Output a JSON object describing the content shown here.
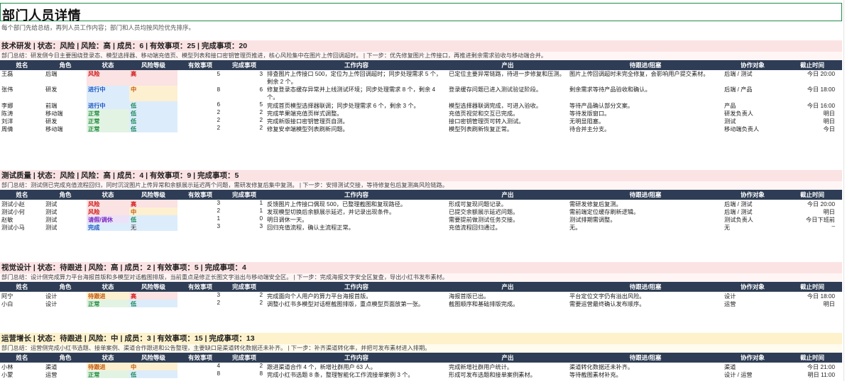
{
  "page": {
    "title": "部门人员详情",
    "subtitle": "每个部门先给总结，再列人员工作内容；部门和人员均按风险优先排序。"
  },
  "columns": [
    "姓名",
    "角色",
    "状态",
    "风险等级",
    "有效事项",
    "完成事项",
    "工作内容",
    "产出",
    "待跟进/阻塞",
    "协作对象",
    "截止时间"
  ],
  "sections": [
    {
      "header": "技术研发 | 状态：风险 | 风险：高 | 成员：6 | 有效事项：25 | 完成事项：20",
      "summary": "部门总结：研发侧今日主要围绕登录态、模型选择器、移动端充值页、模型列表和接口密钥管理页推进，核心风险集中在图片上传回调超时。 | 下一步：优先修复图片上传接口，再推进剩余需求验收与移动端合并。",
      "rows": [
        {
          "name": "王磊",
          "role": "后端",
          "status": "风险",
          "risk": "高",
          "eff": "5",
          "done": "3",
          "work": "排查图片上传接口 500，定位为上传回调超时；同步处理需求 5 个，剩余 2 个。",
          "out": "已定位主要异常链路，待进一步修复和压测。",
          "block": "图片上传回调超时未完全修复，会影响用户提交素材。",
          "collab": "后端 / 测试",
          "due": "今日 20:00"
        },
        {
          "name": "张伟",
          "role": "研发",
          "status": "进行中",
          "risk": "中",
          "eff": "8",
          "done": "6",
          "work": "修复登录态缓存异常并上线测试环境；同步处理需求 8 个，剩余 4 个。",
          "out": "登录缓存问题已进入测试验证阶段。",
          "block": "剩余需求等待产品验收和确认。",
          "collab": "后端 / 产品",
          "due": "今日 18:00"
        },
        {
          "name": "李娜",
          "role": "前端",
          "status": "进行中",
          "risk": "低",
          "eff": "6",
          "done": "5",
          "work": "完成首页模型选择器联调；同步处理需求 6 个，剩余 3 个。",
          "out": "模型选择器联调完成，可进入验收。",
          "block": "等待产品确认部分文案。",
          "collab": "产品",
          "due": "今日 16:00"
        },
        {
          "name": "陈涛",
          "role": "移动端",
          "status": "正常",
          "risk": "低",
          "eff": "2",
          "done": "2",
          "work": "完成苹果端充值页样式调整。",
          "out": "充值页视觉和交互已完成。",
          "block": "等待发版窗口。",
          "collab": "研发负责人",
          "due": "明日"
        },
        {
          "name": "刘洋",
          "role": "研发",
          "status": "正常",
          "risk": "低",
          "eff": "2",
          "done": "2",
          "work": "完成新版接口密钥管理页自测。",
          "out": "接口密钥管理页可转入测试。",
          "block": "无明显阻塞。",
          "collab": "测试",
          "due": "明日"
        },
        {
          "name": "周倩",
          "role": "移动端",
          "status": "正常",
          "risk": "低",
          "eff": "2",
          "done": "2",
          "work": "修复安卓端模型列表刷新问题。",
          "out": "模型列表刷新恢复正常。",
          "block": "待合并主分支。",
          "collab": "移动端负责人",
          "due": "今日"
        }
      ]
    },
    {
      "header": "测试质量 | 状态：风险 | 风险：高 | 成员：4 | 有效事项：9 | 完成事项：5",
      "summary": "部门总结：测试侧已完成充值流程回归，同时沉淀图片上传异常和余额展示延迟两个问题，需研发修复后集中复测。 | 下一步：安排测试交接，等待修复包后复测高风险链路。",
      "rows": [
        {
          "name": "测试小赵",
          "role": "测试",
          "status": "风险",
          "risk": "高",
          "eff": "3",
          "done": "1",
          "work": "反馈图片上传接口偶现 500，已整理截图和复现路径。",
          "out": "形成可复现问题记录。",
          "block": "需研发修复后复测。",
          "collab": "后端 / 测试",
          "due": "今日 20:00"
        },
        {
          "name": "测试小何",
          "role": "测试",
          "status": "风险",
          "risk": "中",
          "eff": "2",
          "done": "1",
          "work": "发现模型切换后余额展示延迟，并记录出现条件。",
          "out": "已提交余额展示延迟问题。",
          "block": "需前端定位缓存刷新逻辑。",
          "collab": "后端 / 测试",
          "due": "明日"
        },
        {
          "name": "赵敏",
          "role": "测试",
          "status": "请假/调休",
          "risk": "低",
          "eff": "1",
          "done": "0",
          "work": "明日调休一天。",
          "out": "需要提前做测试任务交接。",
          "block": "测试排期需调整。",
          "collab": "测试负责人",
          "due": "今日下班前"
        },
        {
          "name": "测试小马",
          "role": "测试",
          "status": "完成",
          "risk": "无",
          "eff": "3",
          "done": "3",
          "work": "回归充值流程，确认主流程正常。",
          "out": "充值流程回归通过。",
          "block": "无。",
          "collab": "无",
          "due": "–"
        }
      ]
    },
    {
      "header": "视觉设计 | 状态：待跟进 | 风险：高 | 成员：2 | 有效事项：5 | 完成事项：4",
      "summary": "部门总结：设计侧完成算力平台海报首版和多模型对话截图排版，当前重点是修正长图文字溢出与移动端安全区。 | 下一步：完成海报文字安全区复查，导出小红书发布素材。",
      "rows": [
        {
          "name": "阿宁",
          "role": "设计",
          "status": "待跟进",
          "risk": "高",
          "eff": "3",
          "done": "2",
          "work": "完成面向个人用户的算力平台海报首版。",
          "out": "海报首版已出。",
          "block": "平台定位文字仍有溢出风险。",
          "collab": "设计",
          "due": "今日 18:00"
        },
        {
          "name": "小白",
          "role": "设计",
          "status": "正常",
          "risk": "低",
          "eff": "2",
          "done": "2",
          "work": "调整小红书多模型对话框截图排版，重点模型页面放第一张。",
          "out": "截图顺序和基础排版完成。",
          "block": "需要运营最终确认发布顺序。",
          "collab": "运营",
          "due": "明日"
        }
      ]
    },
    {
      "header": "运营增长 | 状态：待跟进 | 风险：中 | 成员：3 | 有效事项：15 | 完成事项：13",
      "summary": "部门总结：运营侧完成小红书选题、接单案例、渠道合作跟进和公告整理，主要缺口是渠道转化数据还未补齐。 | 下一步：补齐渠道转化率，并把可发布素材进入排期。",
      "rows": [
        {
          "name": "小林",
          "role": "渠道",
          "status": "待跟进",
          "risk": "中",
          "eff": "4",
          "done": "2",
          "work": "跟进渠道合作 4 个，新增社群用户 63 人。",
          "out": "完成新增社群用户统计。",
          "block": "渠道转化数据还未补齐。",
          "collab": "渠道",
          "due": "今日 21:00"
        },
        {
          "name": "小蒙",
          "role": "运营",
          "status": "正常",
          "risk": "低",
          "eff": "8",
          "done": "8",
          "work": "完成小红书选题 8 条，整理智能化工作流接单案例 3 个。",
          "out": "形成可发布选题和接单案例素材。",
          "block": "等待截图素材补充。",
          "collab": "设计 / 运营",
          "due": "明日 11:00"
        }
      ]
    }
  ]
}
